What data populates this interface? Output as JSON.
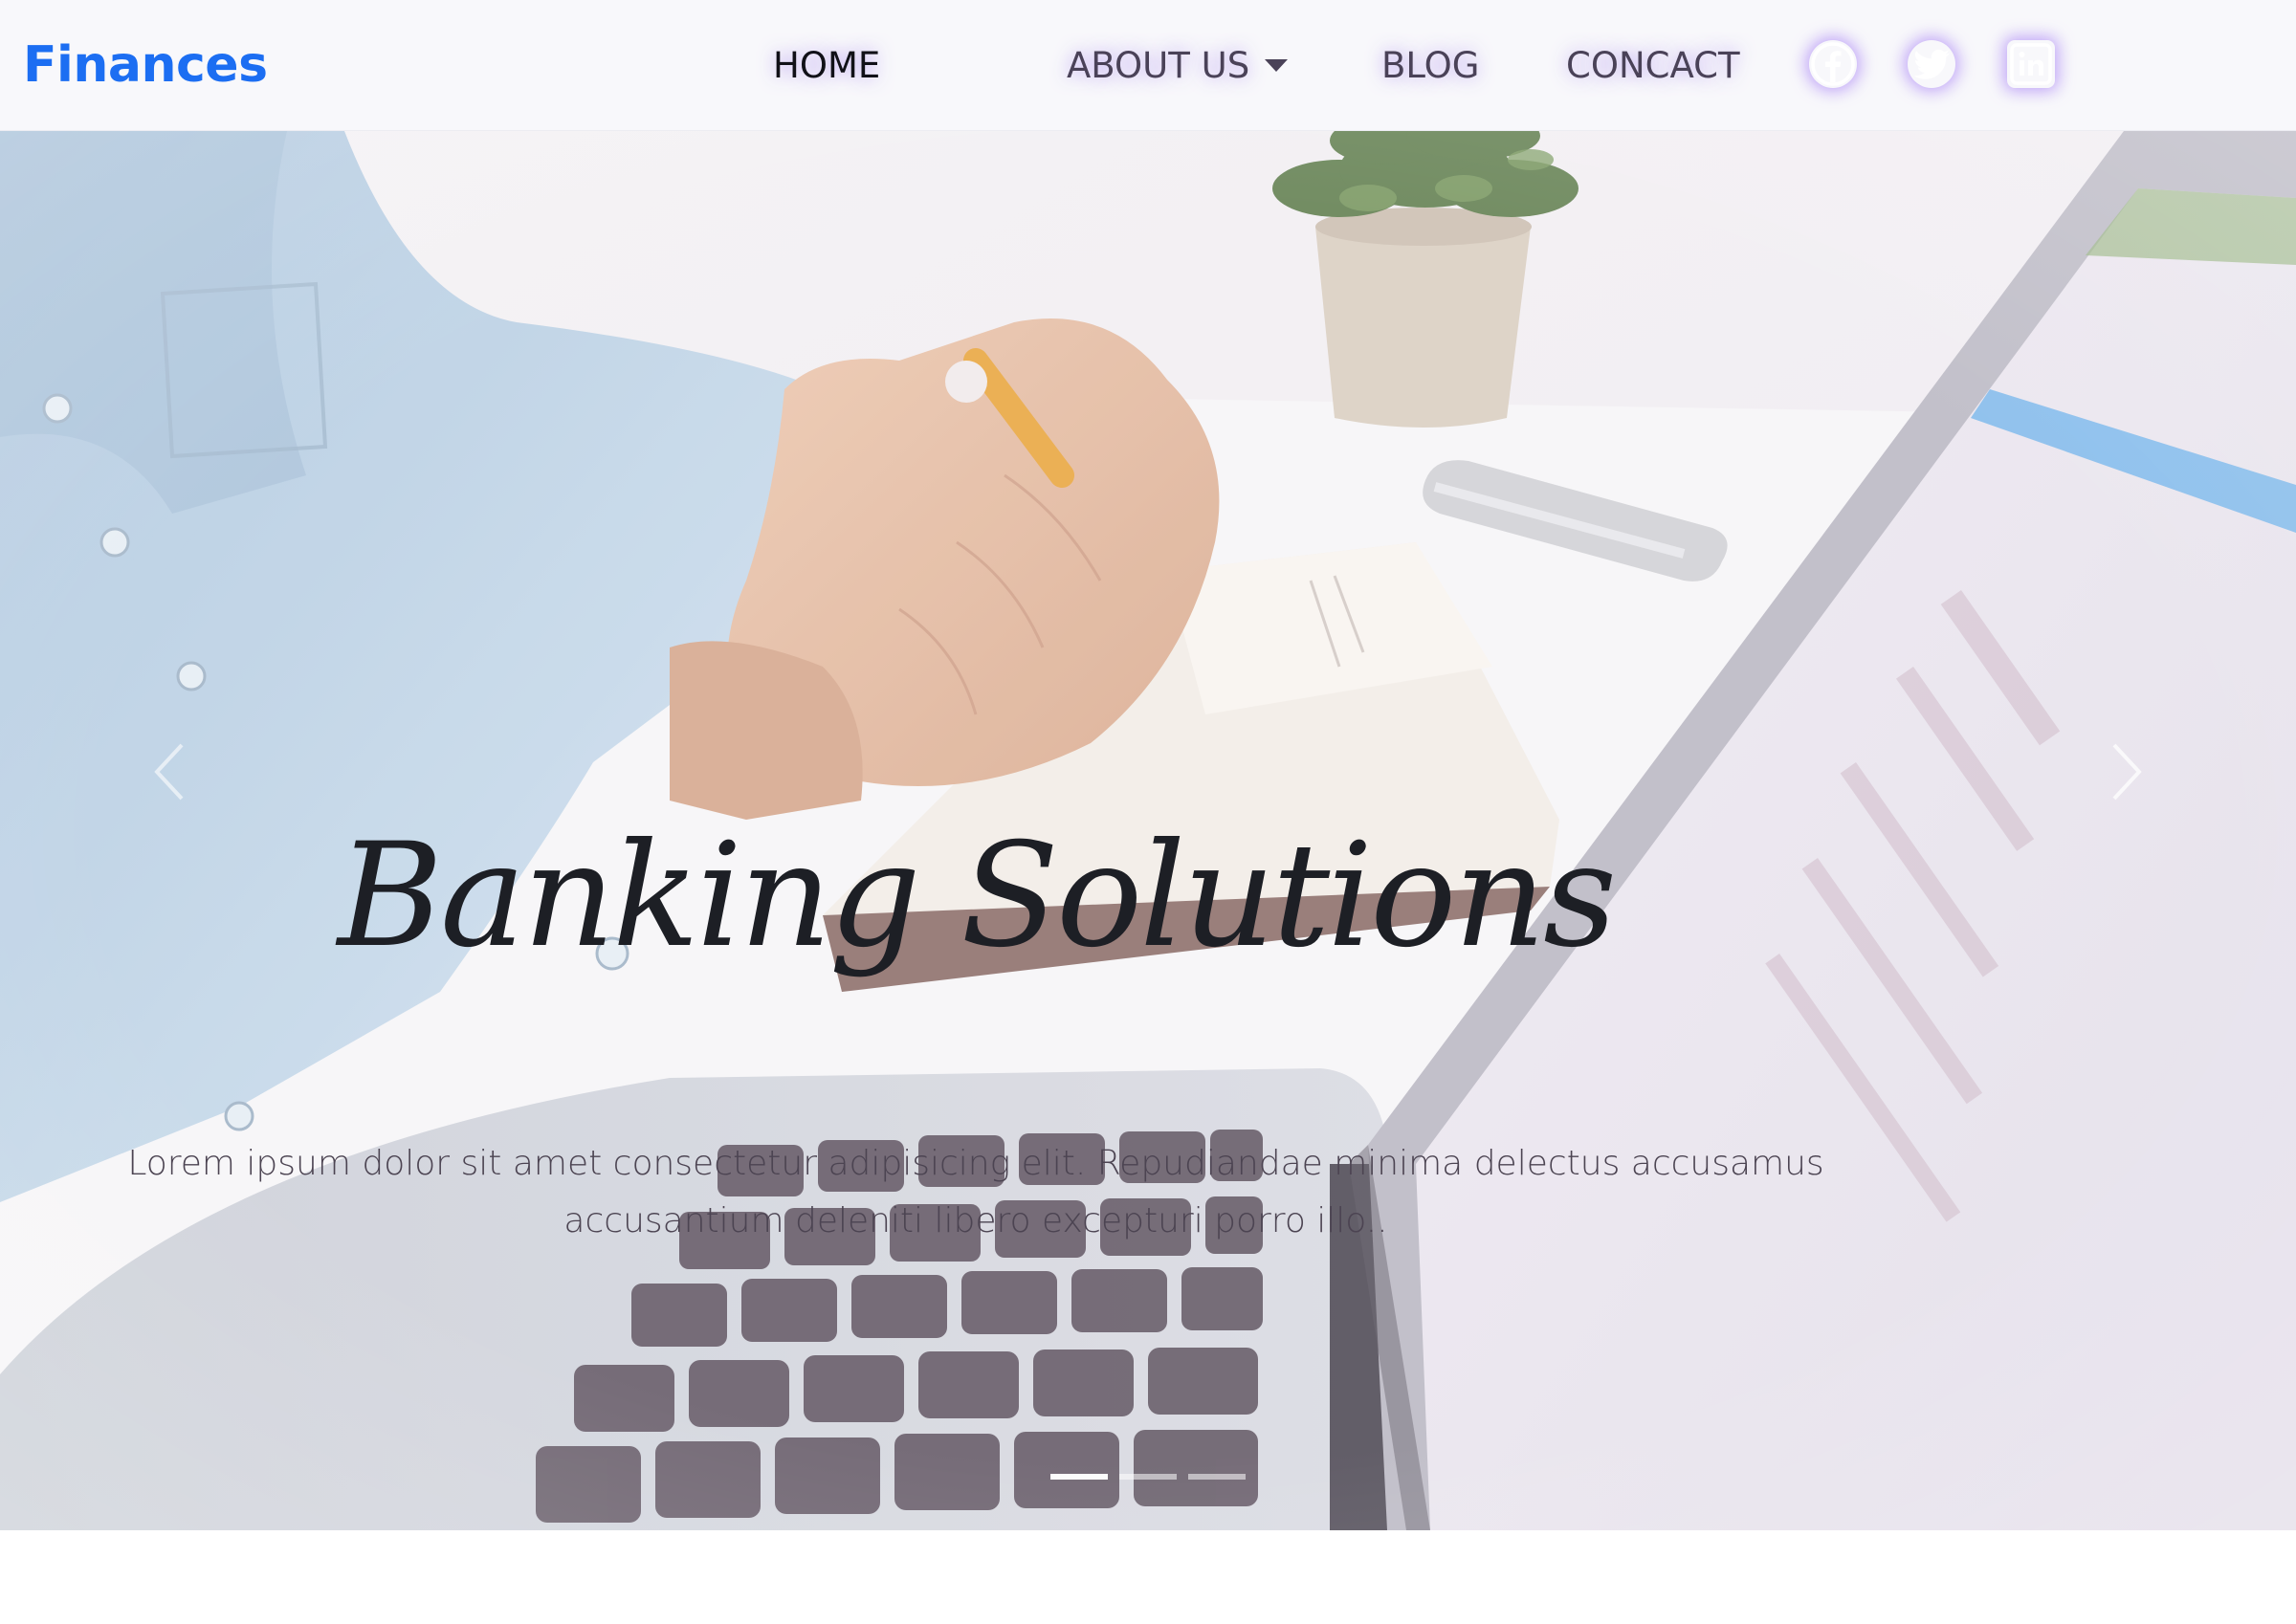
{
  "brand": {
    "name": "Finances",
    "color": "#1c6ef2"
  },
  "nav": {
    "home": "HOME",
    "about": "ABOUT US",
    "blog": "BLOG",
    "contact": "CONCACT",
    "active": "home"
  },
  "social": [
    {
      "name": "facebook",
      "icon": "facebook-icon"
    },
    {
      "name": "twitter",
      "icon": "twitter-icon"
    },
    {
      "name": "linkedin",
      "icon": "linkedin-icon"
    }
  ],
  "hero": {
    "title": "Banking Solutions",
    "text": "Lorem ipsum dolor sit amet consectetur adipisicing elit. Repudiandae minima delectus accusamus accusantium deleniti libero excepturi porro illo..",
    "slides": 3,
    "active_slide": 1
  },
  "colors": {
    "navbar_bg": "#f8f8fb",
    "nav_glow": "#aa8cf0",
    "title": "#1d1f25"
  }
}
